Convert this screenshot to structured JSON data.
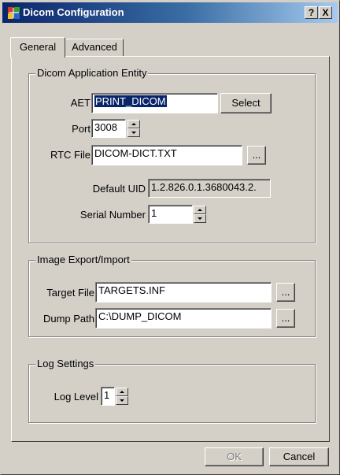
{
  "window": {
    "title": "Dicom Configuration",
    "help_button": "?",
    "close_button": "X"
  },
  "tabs": [
    {
      "label": "General",
      "active": true
    },
    {
      "label": "Advanced",
      "active": false
    }
  ],
  "dicom_ae": {
    "legend": "Dicom Application Entity",
    "aet_label": "AET",
    "aet_value": "PRINT_DICOM",
    "select_button": "Select",
    "port_label": "Port",
    "port_value": "3008",
    "rtc_label": "RTC File",
    "rtc_value": "DICOM-DICT.TXT",
    "browse_button": "...",
    "uid_label": "Default UID",
    "uid_value": "1.2.826.0.1.3680043.2.",
    "serial_label": "Serial Number",
    "serial_value": "1"
  },
  "image_export": {
    "legend": "Image Export/Import",
    "target_label": "Target File",
    "target_value": "TARGETS.INF",
    "target_browse": "...",
    "dump_label": "Dump Path",
    "dump_value": "C:\\DUMP_DICOM",
    "dump_browse": "..."
  },
  "log_settings": {
    "legend": "Log Settings",
    "level_label": "Log Level",
    "level_value": "1"
  },
  "footer": {
    "ok_button": "OK",
    "cancel_button": "Cancel"
  },
  "colors": {
    "titlebar_start": "#0a246a",
    "titlebar_end": "#a6caf0",
    "face": "#d4d0c8",
    "selection": "#0a246a"
  }
}
